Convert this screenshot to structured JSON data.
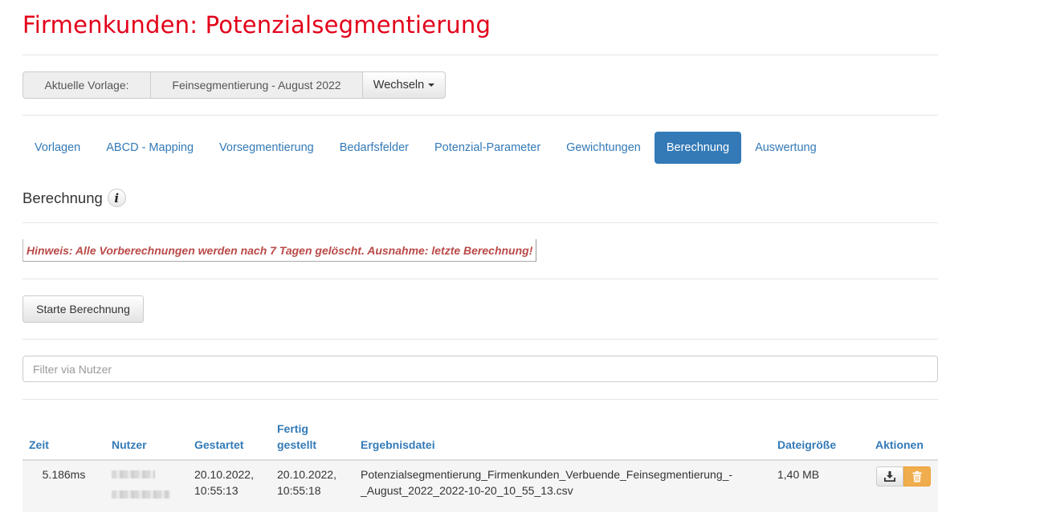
{
  "header": {
    "title": "Firmenkunden: Potenzialsegmentierung"
  },
  "template_selector": {
    "label": "Aktuelle Vorlage:",
    "value": "Feinsegmentierung - August 2022",
    "switch_label": "Wechseln"
  },
  "tabs": [
    {
      "label": "Vorlagen",
      "active": false
    },
    {
      "label": "ABCD - Mapping",
      "active": false
    },
    {
      "label": "Vorsegmentierung",
      "active": false
    },
    {
      "label": "Bedarfsfelder",
      "active": false
    },
    {
      "label": "Potenzial-Parameter",
      "active": false
    },
    {
      "label": "Gewichtungen",
      "active": false
    },
    {
      "label": "Berechnung",
      "active": true
    },
    {
      "label": "Auswertung",
      "active": false
    }
  ],
  "section": {
    "title": "Berechnung",
    "info_icon": "info-icon"
  },
  "hint": "Hinweis: Alle Vorberechnungen werden nach 7 Tagen gelöscht. Ausnahme: letzte Berechnung!",
  "start_button": "Starte Berechnung",
  "filter": {
    "placeholder": "Filter via Nutzer",
    "value": ""
  },
  "table": {
    "headers": {
      "zeit": "Zeit",
      "nutzer": "Nutzer",
      "gestartet": "Gestartet",
      "fertig_1": "Fertig",
      "fertig_2": "gestellt",
      "datei": "Ergebnisdatei",
      "groesse": "Dateigröße",
      "aktionen": "Aktionen"
    },
    "rows": [
      {
        "zeit": "5.186ms",
        "gestartet_date": "20.10.2022,",
        "gestartet_time": "10:55:13",
        "fertig_date": "20.10.2022,",
        "fertig_time": "10:55:18",
        "datei_1": "Potenzialsegmentierung_Firmenkunden_Verbuende_Feinsegmentierung_-",
        "datei_2": "_August_2022_2022-10-20_10_55_13.csv",
        "groesse": "1,40 MB"
      }
    ]
  },
  "colors": {
    "title": "#e2001a",
    "primary": "#337ab7",
    "warning": "#f0ad4e",
    "hint": "#b94a48"
  }
}
